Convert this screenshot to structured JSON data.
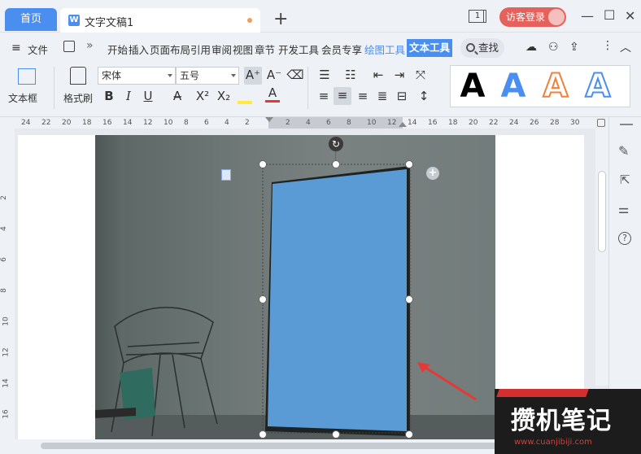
{
  "titlebar": {
    "home_tab": "首页",
    "doc_tab": "文字文稿1",
    "doc_icon": "W",
    "window_count": "1",
    "login_button": "访客登录"
  },
  "menu": {
    "file": "文件",
    "items": [
      "开始",
      "插入",
      "页面布局",
      "引用",
      "审阅",
      "视图",
      "章节",
      "开发工具",
      "会员专享"
    ],
    "drawing_tools": "绘图工具",
    "text_tools": "文本工具",
    "search": "查找"
  },
  "ribbon": {
    "textbox_label": "文本框",
    "format_painter_label": "格式刷",
    "font_name": "宋体",
    "font_size": "五号",
    "bold": "B",
    "italic": "I",
    "underline": "U",
    "wordart_letter": "A"
  },
  "ruler": {
    "ticks": [
      "24",
      "22",
      "20",
      "18",
      "16",
      "14",
      "12",
      "10",
      "8",
      "6",
      "4",
      "2",
      "",
      "2",
      "4",
      "6",
      "8",
      "10",
      "12",
      "14",
      "16",
      "18",
      "20",
      "22",
      "24",
      "26",
      "28",
      "30"
    ],
    "vertical_ticks": [
      "2",
      "4",
      "6",
      "8",
      "10",
      "12",
      "14",
      "16"
    ]
  },
  "watermark": {
    "text": "攒机笔记",
    "url": "www.cuanjibiji.com"
  },
  "colors": {
    "accent": "#4a8ef0",
    "shape_fill": "#5b9bd5",
    "login": "#e5625c",
    "arrow": "#e53935"
  }
}
